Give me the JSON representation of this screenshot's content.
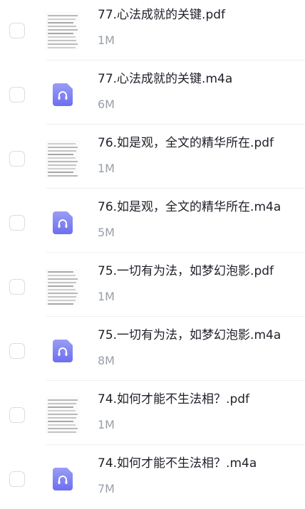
{
  "files": [
    {
      "name": "77.心法成就的关键.pdf",
      "size": "1M",
      "type": "pdf",
      "icon": "pdf-thumbnail"
    },
    {
      "name": "77.心法成就的关键.m4a",
      "size": "6M",
      "type": "audio",
      "icon": "headphones-icon"
    },
    {
      "name": "76.如是观，全文的精华所在.pdf",
      "size": "1M",
      "type": "pdf",
      "icon": "pdf-thumbnail"
    },
    {
      "name": "76.如是观，全文的精华所在.m4a",
      "size": "5M",
      "type": "audio",
      "icon": "headphones-icon"
    },
    {
      "name": "75.一切有为法，如梦幻泡影.pdf",
      "size": "1M",
      "type": "pdf",
      "icon": "pdf-thumbnail"
    },
    {
      "name": "75.一切有为法，如梦幻泡影.m4a",
      "size": "8M",
      "type": "audio",
      "icon": "headphones-icon"
    },
    {
      "name": "74.如何才能不生法相？.pdf",
      "size": "1M",
      "type": "pdf",
      "icon": "pdf-thumbnail"
    },
    {
      "name": "74.如何才能不生法相？.m4a",
      "size": "7M",
      "type": "audio",
      "icon": "headphones-icon"
    }
  ],
  "colors": {
    "audio_icon_top": "#9a9cf7",
    "audio_icon_bottom": "#6d6ff0",
    "title_text": "#1f2129",
    "size_text": "#9aa0a9",
    "checkbox_border": "#dcdde2"
  }
}
